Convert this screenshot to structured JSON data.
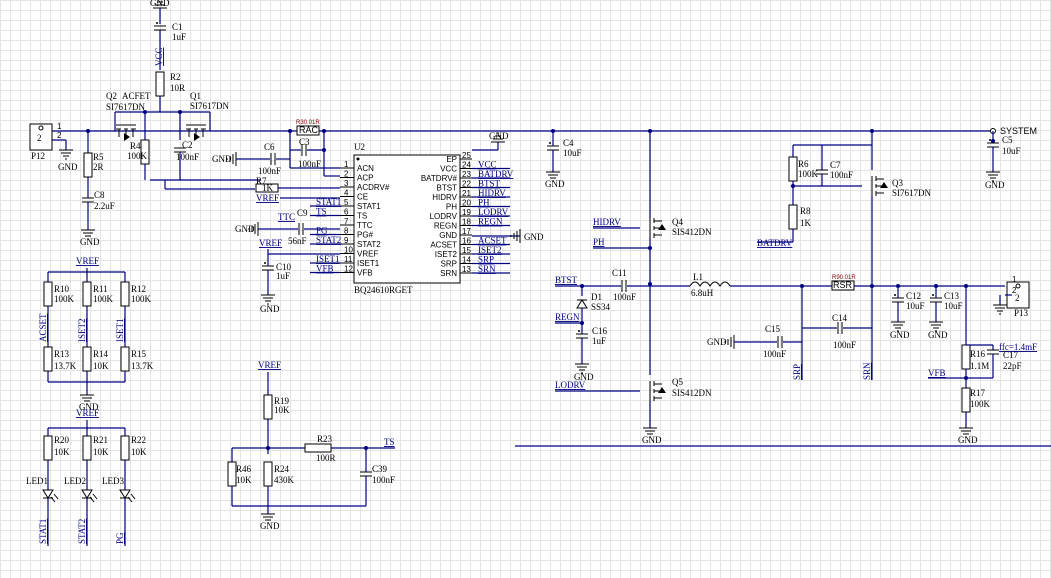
{
  "ic": {
    "ref": "U2",
    "part": "BQ24610RGET",
    "left_pins": [
      {
        "num": "1",
        "name": "ACN",
        "net": ""
      },
      {
        "num": "2",
        "name": "ACP",
        "net": ""
      },
      {
        "num": "3",
        "name": "ACDRV#",
        "net": ""
      },
      {
        "num": "4",
        "name": "CE",
        "net": ""
      },
      {
        "num": "5",
        "name": "STAT1",
        "net": "STAT1"
      },
      {
        "num": "6",
        "name": "TS",
        "net": "TS"
      },
      {
        "num": "7",
        "name": "TTC",
        "net": ""
      },
      {
        "num": "8",
        "name": "PG#",
        "net": "PG"
      },
      {
        "num": "9",
        "name": "STAT2",
        "net": "STAT2"
      },
      {
        "num": "10",
        "name": "VREF",
        "net": ""
      },
      {
        "num": "11",
        "name": "ISET1",
        "net": "ISET1"
      },
      {
        "num": "12",
        "name": "VFB",
        "net": "VFB"
      }
    ],
    "right_pins": [
      {
        "num": "25",
        "name": "EP",
        "net": ""
      },
      {
        "num": "24",
        "name": "VCC",
        "net": "VCC"
      },
      {
        "num": "23",
        "name": "BATDRV#",
        "net": "BATDRV"
      },
      {
        "num": "22",
        "name": "BTST",
        "net": "BTST"
      },
      {
        "num": "21",
        "name": "HIDRV",
        "net": "HIDRV"
      },
      {
        "num": "20",
        "name": "PH",
        "net": "PH"
      },
      {
        "num": "19",
        "name": "LODRV",
        "net": "LODRV"
      },
      {
        "num": "18",
        "name": "REGN",
        "net": "REGN"
      },
      {
        "num": "17",
        "name": "GND",
        "net": "GND"
      },
      {
        "num": "16",
        "name": "ACSET",
        "net": "ACSET"
      },
      {
        "num": "15",
        "name": "ISET2",
        "net": "ISET2"
      },
      {
        "num": "14",
        "name": "SRP",
        "net": "SRP"
      },
      {
        "num": "13",
        "name": "SRN",
        "net": "SRN"
      }
    ]
  },
  "components": {
    "c1": {
      "ref": "C1",
      "val": "1uF"
    },
    "r2": {
      "ref": "R2",
      "val": "10R"
    },
    "q2": {
      "ref": "Q2",
      "tag": "ACFET",
      "val": "SI7617DN"
    },
    "q1": {
      "ref": "Q1",
      "val": "SI7617DN"
    },
    "r4": {
      "ref": "R4",
      "val": "100K"
    },
    "c2": {
      "ref": "C2",
      "val": "100nF"
    },
    "p12": {
      "ref": "P12",
      "pin1": "1",
      "pin2": "2",
      "body": "2"
    },
    "r5": {
      "ref": "R5",
      "val": "2R"
    },
    "c8": {
      "ref": "C8",
      "val": "2.2uF"
    },
    "r_sense1": {
      "ref": "R30.01R",
      "name": "RAC"
    },
    "c3": {
      "ref": "C3",
      "val": "100nF"
    },
    "c6": {
      "ref": "C6",
      "val": "100nF"
    },
    "r7": {
      "ref": "R7",
      "val": "1K"
    },
    "c9": {
      "ref": "C9",
      "val": "56nF"
    },
    "c10": {
      "ref": "C10",
      "val": "1uF"
    },
    "r10": {
      "ref": "R10",
      "val": "100K"
    },
    "r11": {
      "ref": "R11",
      "val": "100K"
    },
    "r12": {
      "ref": "R12",
      "val": "100K"
    },
    "r13": {
      "ref": "R13",
      "val": "13.7K"
    },
    "r14": {
      "ref": "R14",
      "val": "10K"
    },
    "r15": {
      "ref": "R15",
      "val": "13.7K"
    },
    "r20": {
      "ref": "R20",
      "val": "10K"
    },
    "r21": {
      "ref": "R21",
      "val": "10K"
    },
    "r22": {
      "ref": "R22",
      "val": "10K"
    },
    "led1": {
      "ref": "LED1"
    },
    "led2": {
      "ref": "LED2"
    },
    "led3": {
      "ref": "LED3"
    },
    "r19": {
      "ref": "R19",
      "val": "10K"
    },
    "r23": {
      "ref": "R23",
      "val": "100R"
    },
    "r46": {
      "ref": "R46",
      "val": "10K"
    },
    "r24": {
      "ref": "R24",
      "val": "430K"
    },
    "c39": {
      "ref": "C39",
      "val": "100nF"
    },
    "c4": {
      "ref": "C4",
      "val": "10uF"
    },
    "q4": {
      "ref": "Q4",
      "val": "SIS412DN"
    },
    "q5": {
      "ref": "Q5",
      "val": "SIS412DN"
    },
    "c11": {
      "ref": "C11",
      "val": "100nF"
    },
    "d1": {
      "ref": "D1",
      "val": "SS34"
    },
    "c16": {
      "ref": "C16",
      "val": "1uF"
    },
    "l1": {
      "ref": "L1",
      "val": "6.8uH"
    },
    "c15": {
      "ref": "C15",
      "val": "100nF"
    },
    "c14": {
      "ref": "C14",
      "val": "100nF"
    },
    "r_sense2": {
      "ref": "R90.01R",
      "name": "RSR"
    },
    "r6": {
      "ref": "R6",
      "val": "100K"
    },
    "c7": {
      "ref": "C7",
      "val": "100nF"
    },
    "r8": {
      "ref": "R8",
      "val": "1K"
    },
    "q3": {
      "ref": "Q3",
      "val": "SI7617DN"
    },
    "c5": {
      "ref": "C5",
      "val": "10uF"
    },
    "c12": {
      "ref": "C12",
      "val": "10uF"
    },
    "c13": {
      "ref": "C13",
      "val": "10uF"
    },
    "p13": {
      "ref": "P13",
      "pin1": "1",
      "pin2": "2",
      "body": "2"
    },
    "r16": {
      "ref": "R16",
      "val": "1.1M"
    },
    "c17": {
      "ref": "C17",
      "val": "22pF",
      "note": "ffc=1.4mF"
    },
    "r17": {
      "ref": "R17",
      "val": "100K"
    }
  },
  "nets": {
    "gnd": "GND",
    "vcc": "VCC",
    "vref": "VREF",
    "system": "SYSTEM",
    "stat1": "STAT1",
    "stat2": "STAT2",
    "pg": "PG",
    "ts": "TS",
    "ttc": "TTC",
    "vfb": "VFB",
    "iset1": "ISET1",
    "iset2": "ISET2",
    "acset": "ACSET",
    "hidrv": "HIDRV",
    "ph": "PH",
    "btst": "BTST",
    "regn": "REGN",
    "lodrv": "LODRV",
    "batdrv": "BATDRV",
    "srp": "SRP",
    "srn": "SRN"
  },
  "colors": {
    "wire": "#000080",
    "grid": "#e4e4e4",
    "part": "#000000",
    "sense_label": "#800000"
  }
}
